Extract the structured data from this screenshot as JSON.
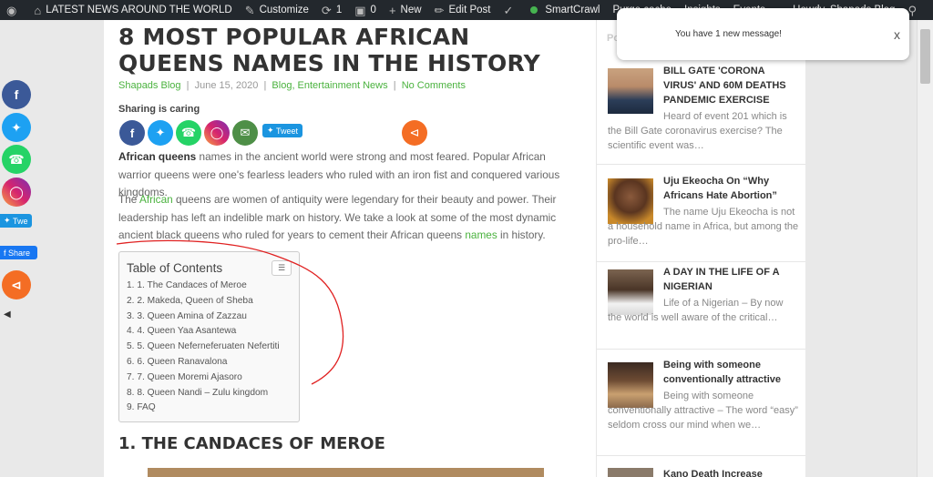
{
  "adminbar": {
    "site": "LATEST NEWS AROUND THE WORLD",
    "customize": "Customize",
    "updates_count": "1",
    "comments_count": "0",
    "new": "New",
    "edit_post": "Edit Post",
    "smartcrawl": "SmartCrawl",
    "purge_cache": "Purge cache",
    "insights": "Insights",
    "events": "Events",
    "howdy": "Howdy, Shapads Blog"
  },
  "article": {
    "title": "8 MOST POPULAR AFRICAN QUEENS NAMES IN THE HISTORY",
    "author": "Shapads Blog",
    "date": "June 15, 2020",
    "categories": "Blog, Entertainment News",
    "comments": "No Comments",
    "sharing_label": "Sharing is caring",
    "tweet_label": "Tweet",
    "para1_bold": "African queens",
    "para1_rest": " names in the ancient world were strong and most feared. Popular African warrior queens were one's fearless leaders who ruled with an iron fist and conquered various kingdoms.",
    "para2_a": "The ",
    "para2_link": "African",
    "para2_b": " queens are women of antiquity were legendary for their beauty and power. Their leadership has left an indelible mark on history. We take a look at some of the most dynamic ancient black queens who ruled for years to cement their African queens ",
    "para2_link2": "names",
    "para2_c": " in history.",
    "toc_title": "Table of Contents",
    "toc_items": [
      "1. 1. The Candaces of Meroe",
      "2. 2. Makeda, Queen of Sheba",
      "3. 3. Queen Amina of Zazzau",
      "4. 4. Queen Yaa Asantewa",
      "5. 5. Queen Neferneferuaten Nefertiti",
      "6. 6. Queen Ranavalona",
      "7. 7. Queen Moremi Ajasoro",
      "8. 8. Queen Nandi – Zulu kingdom",
      "9. FAQ"
    ],
    "h2": "1. THE CANDACES OF MEROE"
  },
  "float_share": {
    "tweet": "Twe",
    "share": "Share"
  },
  "sidebar": {
    "popular_label": "Popular",
    "posts": [
      {
        "title": "BILL GATE 'CORONA VIRUS' AND 60M DEATHS PANDEMIC EXERCISE",
        "excerpt": "Heard of event 201 which is the Bill Gate coronavirus exercise? The scientific event was…"
      },
      {
        "title": "Uju Ekeocha On “Why Africans Hate Abortion”",
        "excerpt": "The name Uju Ekeocha is not a household name in Africa, but among the pro-life…"
      },
      {
        "title": "A DAY IN THE LIFE OF A NIGERIAN",
        "excerpt": "Life of a Nigerian – By now the world is well aware of the critical…"
      },
      {
        "title": "Being with someone conventionally attractive",
        "excerpt": "Being with someone conventionally attractive – The word “easy” seldom cross our mind when we…"
      },
      {
        "title": "Kano Death Increase",
        "excerpt": ""
      }
    ]
  },
  "notification": {
    "message": "You have 1 new message!",
    "close": "x"
  },
  "colors": {
    "accent_green": "#4ab23e",
    "facebook": "#3b5998",
    "twitter": "#1da1f2",
    "whatsapp": "#25d366",
    "share_orange": "#f46d24"
  }
}
